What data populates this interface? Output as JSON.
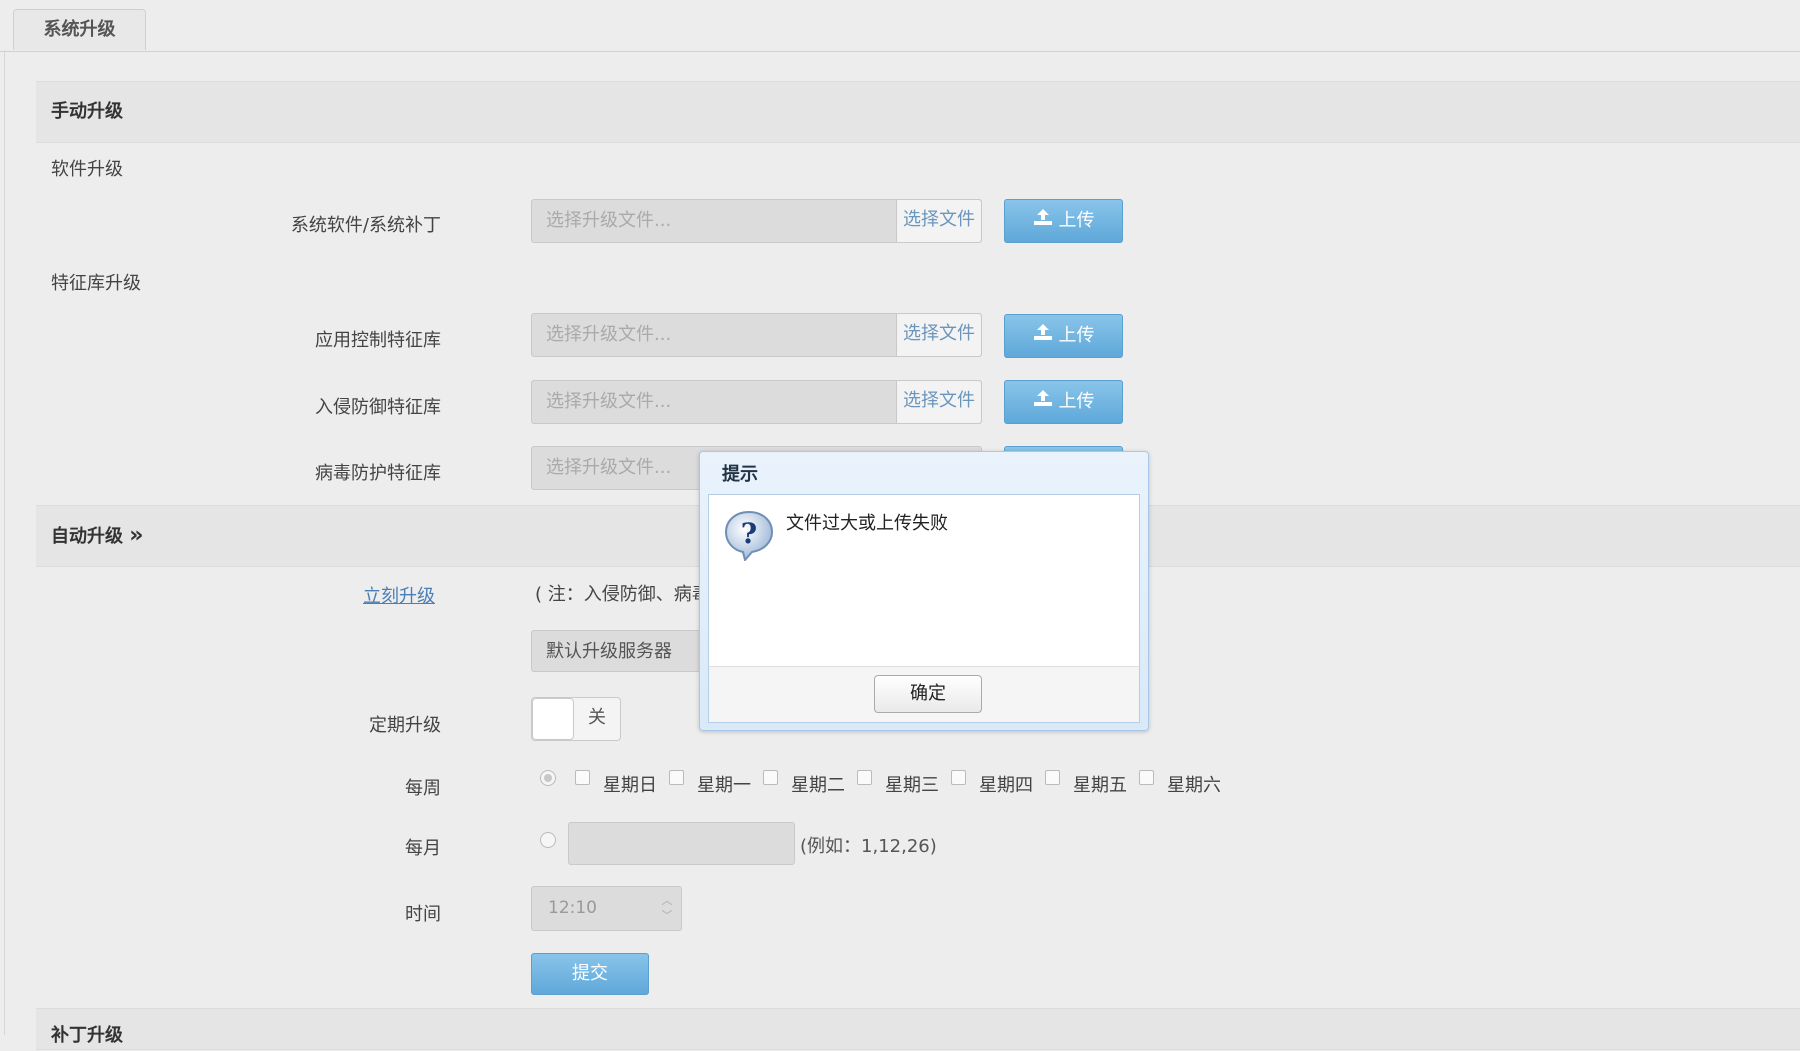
{
  "tabs": [
    {
      "label": "系统升级",
      "active": true
    }
  ],
  "manual": {
    "title": "手动升级",
    "software_group": "软件升级",
    "signature_group": "特征库升级",
    "rows": [
      {
        "label": "系统软件/系统补丁",
        "placeholder": "选择升级文件...",
        "choose": "选择文件",
        "upload": "上传"
      },
      {
        "label": "应用控制特征库",
        "placeholder": "选择升级文件...",
        "choose": "选择文件",
        "upload": "上传"
      },
      {
        "label": "入侵防御特征库",
        "placeholder": "选择升级文件...",
        "choose": "选择文件",
        "upload": "上传"
      },
      {
        "label": "病毒防护特征库",
        "placeholder": "选择升级文件..."
      }
    ]
  },
  "auto": {
    "title": "自动升级",
    "chevron": "»",
    "upgrade_now": "立刻升级",
    "note": "( 注：入侵防御、病毒",
    "server_select": "默认升级服务器",
    "periodic_label": "定期升级",
    "periodic_state": "关",
    "weekly_label": "每周",
    "days": [
      "星期日",
      "星期一",
      "星期二",
      "星期三",
      "星期四",
      "星期五",
      "星期六"
    ],
    "monthly_label": "每月",
    "monthly_example": "(例如：1,12,26)",
    "time_label": "时间",
    "time_value": "12:10",
    "submit": "提交"
  },
  "next_section_title": "补丁升级",
  "dialog": {
    "title": "提示",
    "message": "文件过大或上传失败",
    "ok": "确定"
  },
  "colors": {
    "accent": "#5fa8d9",
    "link": "#4a7fb5",
    "dialog_border": "#a9c7e6"
  }
}
